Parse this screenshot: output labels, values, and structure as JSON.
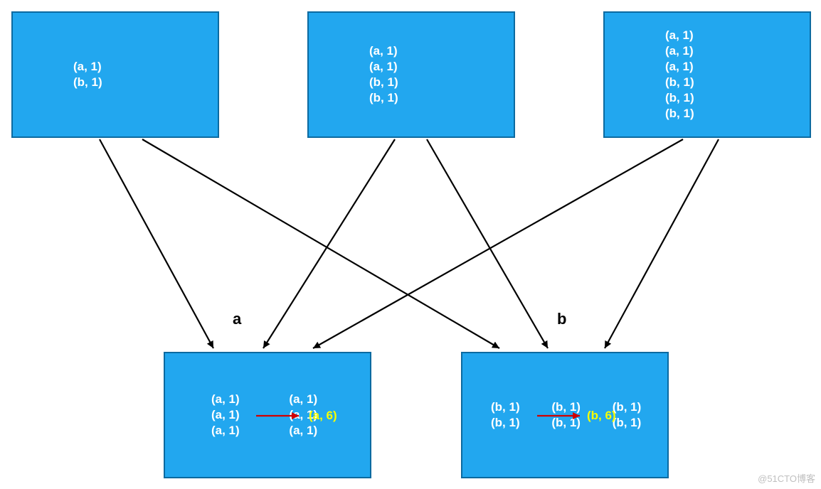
{
  "boxes": {
    "top1": {
      "lines": [
        "(a, 1)",
        "(b, 1)"
      ]
    },
    "top2": {
      "lines": [
        "(a, 1)",
        "(a, 1)",
        "(b, 1)",
        "(b, 1)"
      ]
    },
    "top3": {
      "lines": [
        "(a, 1)",
        "(a, 1)",
        "(a, 1)",
        "(b, 1)",
        "(b, 1)",
        "(b, 1)"
      ]
    },
    "bottomA": {
      "lines": [
        "(a, 1)",
        "(a, 1)",
        "(a, 1)",
        "(a, 1)",
        "(a, 1)",
        "(a, 1)"
      ],
      "result": "(a, 6)"
    },
    "bottomB": {
      "lines": [
        "(b, 1)",
        "(b, 1)",
        "(b, 1)",
        "(b, 1)",
        "(b, 1)",
        "(b, 1)"
      ],
      "result": "(b, 6)"
    }
  },
  "labels": {
    "a": "a",
    "b": "b"
  },
  "watermark": "@51CTO博客"
}
